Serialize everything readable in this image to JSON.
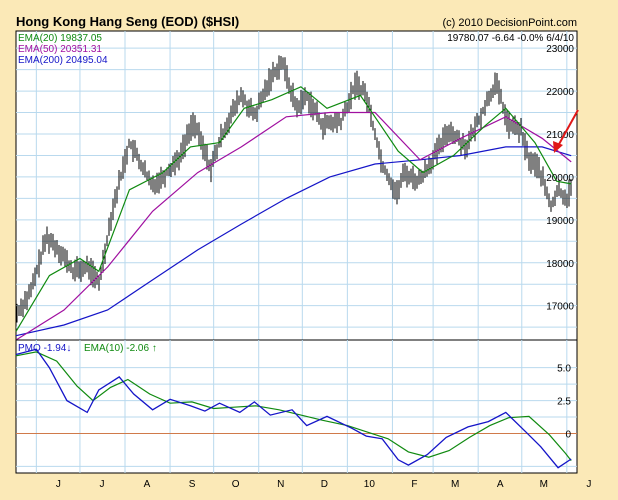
{
  "header": {
    "title": "Hong Kong Hang Seng (EOD) ($HSI)",
    "copyright": "(c) 2010 DecisionPoint.com",
    "last_quote": "19780.07  -6.64  -0.0%  6/4/10"
  },
  "colors": {
    "page_bg": "#fbe9b7",
    "plot_bg": "#ffffff",
    "grid": "#b9d9ee",
    "price_bars": "#000000",
    "ema20": "#108a10",
    "ema50": "#a010a0",
    "ema200": "#1515c8",
    "pmo": "#1515c8",
    "pmo_ema": "#108a10",
    "zero_line": "#d07a4a",
    "annotation_arrow": "#e01818"
  },
  "chart_data": [
    {
      "type": "line",
      "panel": "price",
      "title": "Hong Kong Hang Seng (EOD) ($HSI)",
      "ylim": [
        16200,
        23400
      ],
      "y_ticks": [
        17000,
        18000,
        19000,
        20000,
        21000,
        22000,
        23000
      ],
      "y_tick_labels": [
        "17000",
        "18000",
        "19000",
        "20000",
        "21000",
        "22000",
        "23000"
      ],
      "x_tick_labels": [
        "J",
        "J",
        "A",
        "S",
        "O",
        "N",
        "D",
        "10",
        "F",
        "M",
        "A",
        "M",
        "J"
      ],
      "x_tick_dates": [
        "2009-06-01",
        "2009-07-01",
        "2009-08-01",
        "2009-09-01",
        "2009-10-01",
        "2009-11-01",
        "2009-12-01",
        "2010-01-01",
        "2010-02-01",
        "2010-03-01",
        "2010-04-01",
        "2010-05-01",
        "2010-06-01"
      ],
      "grid": true,
      "legend_position": "top-left",
      "legend": [
        {
          "label": "EMA(20)",
          "value": "19837.05"
        },
        {
          "label": "EMA(50)",
          "value": "20351.31"
        },
        {
          "label": "EMA(200)",
          "value": "20495.04"
        }
      ],
      "price_anchors": {
        "x": [
          "2009-05-18",
          "2009-05-28",
          "2009-06-08",
          "2009-06-17",
          "2009-06-26",
          "2009-07-07",
          "2009-07-14",
          "2009-07-23",
          "2009-08-04",
          "2009-08-12",
          "2009-08-19",
          "2009-08-27",
          "2009-09-08",
          "2009-09-17",
          "2009-09-29",
          "2009-10-08",
          "2009-10-20",
          "2009-10-29",
          "2009-11-09",
          "2009-11-17",
          "2009-11-27",
          "2009-12-04",
          "2009-12-15",
          "2009-12-28",
          "2010-01-07",
          "2010-01-14",
          "2010-01-25",
          "2010-02-04",
          "2010-02-09",
          "2010-02-19",
          "2010-03-04",
          "2010-03-12",
          "2010-03-24",
          "2010-04-01",
          "2010-04-13",
          "2010-04-22",
          "2010-04-30",
          "2010-05-06",
          "2010-05-13",
          "2010-05-21",
          "2010-05-26",
          "2010-06-01",
          "2010-06-04"
        ],
        "y": [
          16800,
          17300,
          18600,
          18300,
          17800,
          17900,
          17500,
          19200,
          20800,
          20300,
          19800,
          20000,
          20500,
          21300,
          20200,
          21100,
          21900,
          21400,
          22300,
          22700,
          21600,
          21900,
          21200,
          21300,
          22200,
          21900,
          20300,
          19600,
          20100,
          19900,
          20600,
          21100,
          20700,
          21300,
          22200,
          21200,
          21100,
          20400,
          20200,
          19300,
          19700,
          19500,
          19780
        ]
      },
      "ema20": {
        "x": [
          "2009-05-18",
          "2009-06-10",
          "2009-07-01",
          "2009-07-14",
          "2009-08-04",
          "2009-08-27",
          "2009-09-15",
          "2009-10-05",
          "2009-10-22",
          "2009-11-10",
          "2009-11-30",
          "2009-12-18",
          "2010-01-10",
          "2010-02-05",
          "2010-02-22",
          "2010-03-15",
          "2010-04-06",
          "2010-04-20",
          "2010-05-10",
          "2010-05-25",
          "2010-06-04"
        ],
        "y": [
          16400,
          17700,
          18100,
          17800,
          19700,
          20100,
          20700,
          20800,
          21600,
          21800,
          22100,
          21600,
          21900,
          20600,
          20100,
          20500,
          21200,
          21600,
          20800,
          19900,
          19837
        ]
      },
      "ema50": {
        "x": [
          "2009-05-18",
          "2009-06-20",
          "2009-07-20",
          "2009-08-20",
          "2009-09-20",
          "2009-10-20",
          "2009-11-20",
          "2009-12-20",
          "2010-01-20",
          "2010-02-20",
          "2010-03-20",
          "2010-04-20",
          "2010-05-15",
          "2010-06-04"
        ],
        "y": [
          16200,
          16900,
          17900,
          19200,
          20100,
          20700,
          21400,
          21500,
          21500,
          20400,
          20900,
          21400,
          20900,
          20351
        ]
      },
      "ema200": {
        "x": [
          "2009-05-18",
          "2009-06-20",
          "2009-07-20",
          "2009-08-20",
          "2009-09-20",
          "2009-10-20",
          "2009-11-20",
          "2009-12-20",
          "2010-01-20",
          "2010-02-20",
          "2010-03-20",
          "2010-04-20",
          "2010-05-15",
          "2010-06-04"
        ],
        "y": [
          16300,
          16550,
          16900,
          17600,
          18300,
          18900,
          19500,
          20000,
          20300,
          20400,
          20500,
          20700,
          20700,
          20495
        ]
      }
    },
    {
      "type": "line",
      "panel": "pmo",
      "ylim": [
        -3.0,
        7.1
      ],
      "y_ticks": [
        5,
        2.5,
        0
      ],
      "y_tick_labels": [
        "5.0",
        "2.5",
        "0"
      ],
      "zero_line": 0,
      "grid": true,
      "legend_position": "top-left",
      "legend": [
        {
          "label": "PMO",
          "value": "-1.94",
          "symbol": "↓"
        },
        {
          "label": "EMA(10)",
          "value": "-2.06",
          "symbol": "↑"
        }
      ],
      "series": [
        {
          "name": "PMO",
          "x": [
            "2009-05-18",
            "2009-06-01",
            "2009-06-10",
            "2009-06-22",
            "2009-07-06",
            "2009-07-14",
            "2009-07-28",
            "2009-08-07",
            "2009-08-20",
            "2009-09-01",
            "2009-09-15",
            "2009-09-25",
            "2009-10-05",
            "2009-10-19",
            "2009-10-29",
            "2009-11-09",
            "2009-11-24",
            "2009-12-04",
            "2009-12-18",
            "2010-01-04",
            "2010-01-14",
            "2010-01-25",
            "2010-02-05",
            "2010-02-12",
            "2010-02-25",
            "2010-03-10",
            "2010-03-25",
            "2010-04-08",
            "2010-04-20",
            "2010-05-04",
            "2010-05-14",
            "2010-05-26",
            "2010-06-04"
          ],
          "y": [
            6.0,
            6.4,
            5.0,
            2.5,
            1.6,
            3.3,
            4.3,
            3.0,
            1.8,
            2.6,
            2.1,
            1.7,
            2.3,
            1.6,
            2.4,
            1.4,
            1.8,
            0.6,
            1.3,
            0.4,
            -0.2,
            -0.4,
            -2.0,
            -2.4,
            -1.6,
            -0.3,
            0.5,
            0.9,
            1.6,
            0.1,
            -1.0,
            -2.6,
            -1.94
          ]
        },
        {
          "name": "EMA(10)",
          "x": [
            "2009-05-18",
            "2009-06-01",
            "2009-06-15",
            "2009-06-29",
            "2009-07-10",
            "2009-07-22",
            "2009-08-03",
            "2009-08-18",
            "2009-09-01",
            "2009-09-16",
            "2009-10-01",
            "2009-10-15",
            "2009-10-30",
            "2009-11-15",
            "2009-11-30",
            "2009-12-15",
            "2010-01-01",
            "2010-01-15",
            "2010-01-29",
            "2010-02-12",
            "2010-02-26",
            "2010-03-12",
            "2010-03-26",
            "2010-04-09",
            "2010-04-22",
            "2010-05-06",
            "2010-05-20",
            "2010-05-31",
            "2010-06-04"
          ],
          "y": [
            5.9,
            6.2,
            5.5,
            3.6,
            2.5,
            3.5,
            4.1,
            3.0,
            2.3,
            2.4,
            1.9,
            2.0,
            2.1,
            1.8,
            1.4,
            1.0,
            0.6,
            0.1,
            -0.4,
            -1.4,
            -1.8,
            -1.3,
            -0.3,
            0.6,
            1.2,
            1.3,
            -0.1,
            -1.5,
            -2.06
          ]
        }
      ]
    }
  ]
}
